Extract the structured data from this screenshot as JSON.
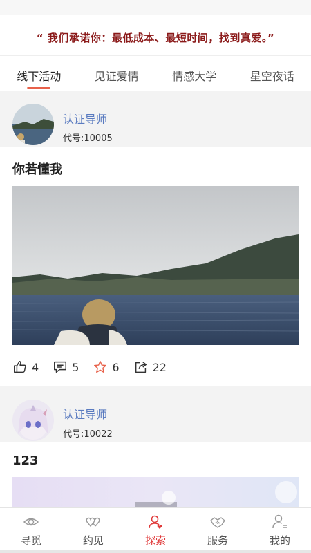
{
  "slogan": "“ 我们承诺你：最低成本、最短时间，找到真爱。”",
  "tabs": [
    {
      "label": "线下活动",
      "active": true
    },
    {
      "label": "见证爱情",
      "active": false
    },
    {
      "label": "情感大学",
      "active": false
    },
    {
      "label": "星空夜话",
      "active": false
    }
  ],
  "posts": [
    {
      "author_title": "认证导师",
      "author_code": "代号:10005",
      "title": "你若懂我",
      "likes": "4",
      "comments": "5",
      "favorites": "6",
      "shares": "22"
    },
    {
      "author_title": "认证导师",
      "author_code": "代号:10022",
      "title": "123"
    }
  ],
  "bottom_nav": [
    {
      "label": "寻觅",
      "icon": "eye-icon",
      "active": false
    },
    {
      "label": "约见",
      "icon": "hearts-icon",
      "active": false
    },
    {
      "label": "探索",
      "icon": "explore-user-icon",
      "active": true
    },
    {
      "label": "服务",
      "icon": "handshake-icon",
      "active": false
    },
    {
      "label": "我的",
      "icon": "profile-icon",
      "active": false
    }
  ],
  "colors": {
    "accent": "#e03a3a",
    "slogan": "#8b1a1a",
    "author_title": "#5a7bc0",
    "tab_underline": "#e8614a",
    "card_header_bg": "#f3f3f3"
  }
}
